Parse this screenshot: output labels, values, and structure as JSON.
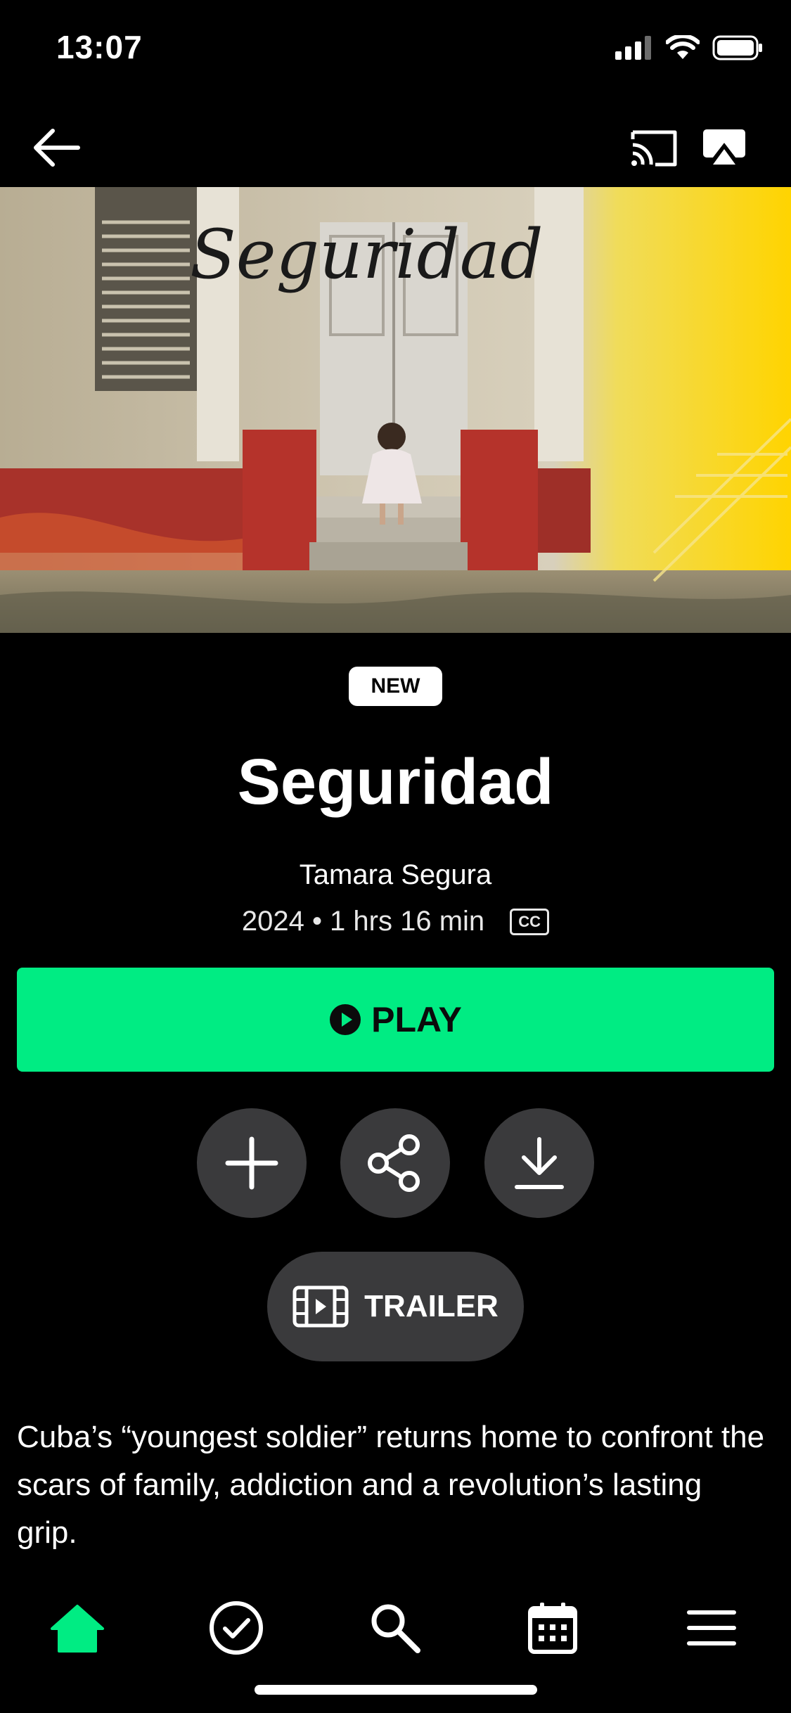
{
  "status_bar": {
    "time": "13:07",
    "icons": [
      "signal-icon",
      "wifi-icon",
      "battery-icon"
    ]
  },
  "nav": {
    "icons": [
      "back-arrow-icon",
      "cast-icon",
      "airplay-icon"
    ]
  },
  "hero": {
    "image_title_text": "Seguridad"
  },
  "film": {
    "badge": "NEW",
    "title": "Seguridad",
    "director": "Tamara Segura",
    "meta": "2024 • 1 hrs 16 min",
    "cc_label": "CC"
  },
  "actions": {
    "play_label": "PLAY",
    "icons": [
      "add-icon",
      "share-icon",
      "download-icon"
    ],
    "trailer_label": "TRAILER"
  },
  "description": "Cuba’s “youngest soldier” returns home to confront the scars of family, addiction and a revolution’s lasting grip.",
  "tab_bar": {
    "tabs": [
      "home",
      "watchlist",
      "search",
      "schedule",
      "menu"
    ],
    "active": "home"
  },
  "colors": {
    "accent": "#00ec83",
    "background": "#000000",
    "button_gray": "#3a3a3c"
  }
}
